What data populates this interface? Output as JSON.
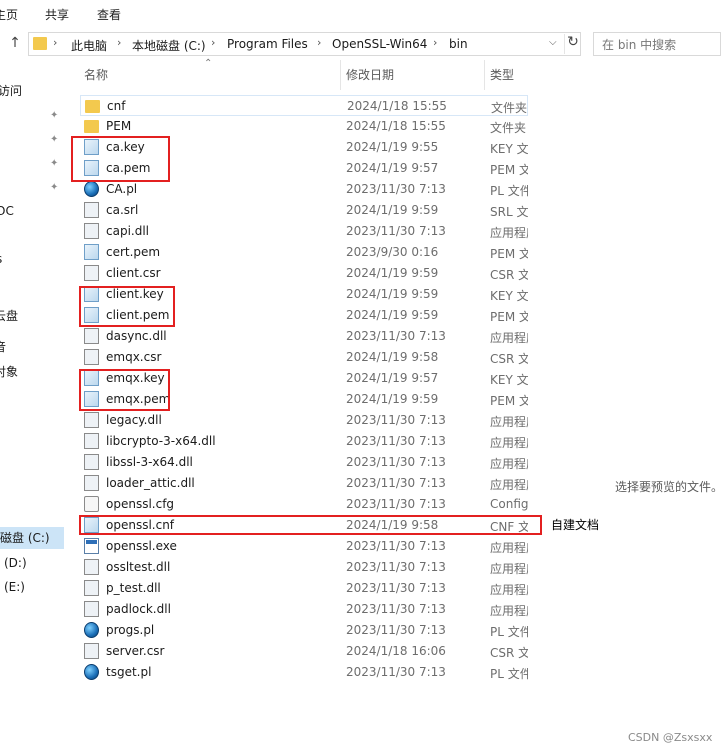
{
  "ribbon": {
    "tab_home": "主页",
    "tab_share": "共享",
    "tab_view": "查看"
  },
  "address": {
    "crumbs": [
      "此电脑",
      "本地磁盘 (C:)",
      "Program Files",
      "OpenSSL-Win64",
      "bin"
    ],
    "separator": "›"
  },
  "search": {
    "placeholder": "在 bin 中搜索"
  },
  "nav": {
    "items": [
      {
        "label": "访问"
      },
      {
        "label": "OC"
      },
      {
        "label": "s"
      },
      {
        "label": "云盘"
      },
      {
        "label": "音"
      },
      {
        "label": "对象"
      },
      {
        "label": "磁盘 (C:)"
      },
      {
        "label": "(D:)"
      },
      {
        "label": "(E:)"
      }
    ]
  },
  "columns": {
    "name": "名称",
    "date": "修改日期",
    "type": "类型"
  },
  "files": [
    {
      "name": "cnf",
      "date": "2024/1/18 15:55",
      "type": "文件夹",
      "icon": "folder-icon"
    },
    {
      "name": "PEM",
      "date": "2024/1/18 15:55",
      "type": "文件夹",
      "icon": "folder-icon"
    },
    {
      "name": "ca.key",
      "date": "2024/1/19 9:55",
      "type": "KEY 文件",
      "icon": "key-file-icon"
    },
    {
      "name": "ca.pem",
      "date": "2024/1/19 9:57",
      "type": "PEM 文件",
      "icon": "key-file-icon"
    },
    {
      "name": "CA.pl",
      "date": "2023/11/30 7:13",
      "type": "PL 文件",
      "icon": "perl-file-icon"
    },
    {
      "name": "ca.srl",
      "date": "2024/1/19 9:59",
      "type": "SRL 文件",
      "icon": "file-icon"
    },
    {
      "name": "capi.dll",
      "date": "2023/11/30 7:13",
      "type": "应用程序扩展",
      "icon": "dll-file-icon"
    },
    {
      "name": "cert.pem",
      "date": "2023/9/30 0:16",
      "type": "PEM 文件",
      "icon": "key-file-icon"
    },
    {
      "name": "client.csr",
      "date": "2024/1/19 9:59",
      "type": "CSR 文件",
      "icon": "file-icon"
    },
    {
      "name": "client.key",
      "date": "2024/1/19 9:59",
      "type": "KEY 文件",
      "icon": "key-file-icon"
    },
    {
      "name": "client.pem",
      "date": "2024/1/19 9:59",
      "type": "PEM 文件",
      "icon": "key-file-icon"
    },
    {
      "name": "dasync.dll",
      "date": "2023/11/30 7:13",
      "type": "应用程序扩展",
      "icon": "dll-file-icon"
    },
    {
      "name": "emqx.csr",
      "date": "2024/1/19 9:58",
      "type": "CSR 文件",
      "icon": "file-icon"
    },
    {
      "name": "emqx.key",
      "date": "2024/1/19 9:57",
      "type": "KEY 文件",
      "icon": "key-file-icon"
    },
    {
      "name": "emqx.pem",
      "date": "2024/1/19 9:59",
      "type": "PEM 文件",
      "icon": "key-file-icon"
    },
    {
      "name": "legacy.dll",
      "date": "2023/11/30 7:13",
      "type": "应用程序扩展",
      "icon": "dll-file-icon"
    },
    {
      "name": "libcrypto-3-x64.dll",
      "date": "2023/11/30 7:13",
      "type": "应用程序扩展",
      "icon": "dll-file-icon"
    },
    {
      "name": "libssl-3-x64.dll",
      "date": "2023/11/30 7:13",
      "type": "应用程序扩展",
      "icon": "dll-file-icon"
    },
    {
      "name": "loader_attic.dll",
      "date": "2023/11/30 7:13",
      "type": "应用程序扩展",
      "icon": "dll-file-icon"
    },
    {
      "name": "openssl.cfg",
      "date": "2023/11/30 7:13",
      "type": "Configuration",
      "icon": "config-file-icon"
    },
    {
      "name": "openssl.cnf",
      "date": "2024/1/19 9:58",
      "type": "CNF 文件",
      "icon": "key-file-icon"
    },
    {
      "name": "openssl.exe",
      "date": "2023/11/30 7:13",
      "type": "应用程序",
      "icon": "exe-file-icon"
    },
    {
      "name": "ossltest.dll",
      "date": "2023/11/30 7:13",
      "type": "应用程序扩展",
      "icon": "dll-file-icon"
    },
    {
      "name": "p_test.dll",
      "date": "2023/11/30 7:13",
      "type": "应用程序扩展",
      "icon": "dll-file-icon"
    },
    {
      "name": "padlock.dll",
      "date": "2023/11/30 7:13",
      "type": "应用程序扩展",
      "icon": "dll-file-icon"
    },
    {
      "name": "progs.pl",
      "date": "2023/11/30 7:13",
      "type": "PL 文件",
      "icon": "perl-file-icon"
    },
    {
      "name": "server.csr",
      "date": "2024/1/18 16:06",
      "type": "CSR 文件",
      "icon": "file-icon"
    },
    {
      "name": "tsget.pl",
      "date": "2023/11/30 7:13",
      "type": "PL 文件",
      "icon": "perl-file-icon"
    }
  ],
  "annotation": "自建文档",
  "preview_text": "选择要预览的文件。",
  "watermark": "CSDN @Zsxsxx",
  "colors": {
    "highlight": "#e32020",
    "selection": "#cce4f7",
    "folder": "#f3c94e"
  }
}
